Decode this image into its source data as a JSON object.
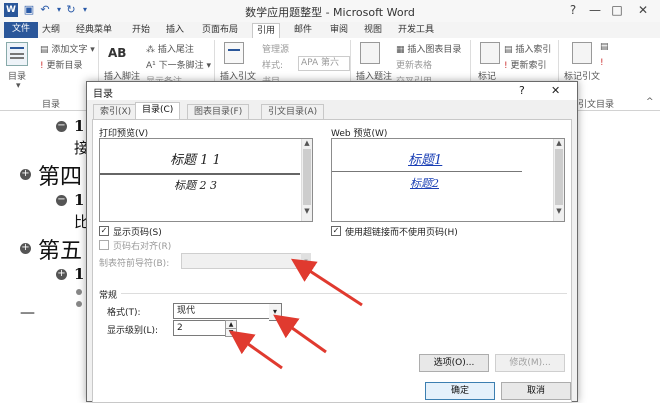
{
  "window": {
    "title": "数学应用题整型 - Microsoft Word",
    "help": "?",
    "minimize": "—",
    "restore": "□",
    "close": "✕"
  },
  "ribbon_tabs": [
    {
      "label": "文件",
      "icon": "word-icon"
    },
    {
      "label": "大纲"
    },
    {
      "label": "经典菜单"
    },
    {
      "label": "开始"
    },
    {
      "label": "插入"
    },
    {
      "label": "页面布局"
    },
    {
      "label": "引用"
    },
    {
      "label": "邮件"
    },
    {
      "label": "审阅"
    },
    {
      "label": "视图"
    },
    {
      "label": "开发工具"
    }
  ],
  "ribbon": {
    "toc": {
      "big": "目录",
      "add_text": "添加文字",
      "update": "更新目录",
      "group": "目录"
    },
    "footnote": {
      "big1": "AB",
      "big2": "插入脚注",
      "insert_endnote": "插入尾注",
      "next_footnote": "下一条脚注",
      "show_notes": "显示备注"
    },
    "citation": {
      "big": "插入引文",
      "manage": "管理源",
      "style_label": "样式:",
      "style_value": "APA 第六",
      "bibliography": "书目"
    },
    "caption": {
      "big": "插入题注",
      "insert_table": "插入图表目录",
      "update_table": "更新表格",
      "cross_ref": "交叉引用"
    },
    "index": {
      "big": "标记",
      "insert_index": "插入索引",
      "update_index": "更新索引"
    },
    "authorities": {
      "big": "标记引文",
      "group": "引文目录"
    }
  },
  "document": {
    "h1a": "第四",
    "h1b": "第五",
    "b1": "1",
    "b2": "1",
    "b3": "1",
    "snip1": "接",
    "snip2": "比",
    "dash": "—"
  },
  "dialog": {
    "title": "目录",
    "help": "?",
    "close": "✕",
    "tabs": [
      "索引(X)",
      "目录(C)",
      "图表目录(F)",
      "引文目录(A)"
    ],
    "print_preview_label": "打印预览(V)",
    "print_heading1": "标题 1 1",
    "print_heading2": "标题 2 3",
    "web_preview_label": "Web 预览(W)",
    "web_heading1": "标题1",
    "web_heading2": "标题2",
    "show_page_numbers": "显示页码(S)",
    "right_align": "页码右对齐(R)",
    "tab_leader": "制表符前导符(B):",
    "use_hyperlinks": "使用超链接而不使用页码(H)",
    "general": "常规",
    "formats_label": "格式(T):",
    "formats_value": "现代",
    "levels_label": "显示级别(L):",
    "levels_value": "2",
    "options": "选项(O)...",
    "modify": "修改(M)...",
    "ok": "确定",
    "cancel": "取消"
  },
  "colors": {
    "word_blue": "#2b579a",
    "arrow_red": "#e03a2f",
    "hyperlink": "#1a3fb5"
  }
}
